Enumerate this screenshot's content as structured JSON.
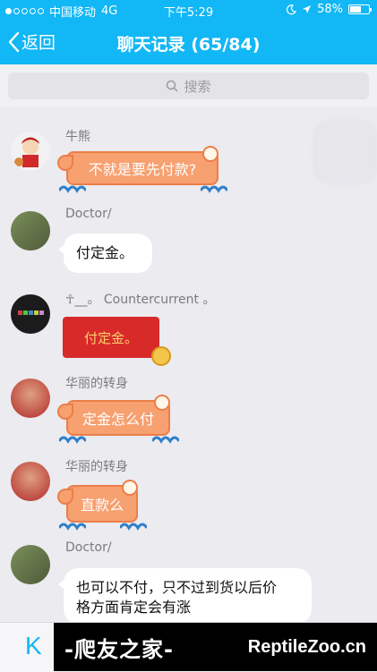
{
  "status_bar": {
    "carrier": "中国移动",
    "network": "4G",
    "time": "下午5:29",
    "battery": "58%",
    "battery_level": 0.58
  },
  "nav": {
    "back_label": "返回",
    "title": "聊天记录 (65/84)"
  },
  "search": {
    "placeholder": "搜索"
  },
  "messages": [
    {
      "sender": "牛熊",
      "text": "不就是要先付款?",
      "style": "fancy-orange"
    },
    {
      "sender": "Doctor/",
      "text": "付定金。",
      "style": "white"
    },
    {
      "sender": "☥__。 Countercurrent 。",
      "text": "付定金。",
      "style": "red-packet"
    },
    {
      "sender": "华丽的转身",
      "text": "定金怎么付",
      "style": "fancy-orange"
    },
    {
      "sender": "华丽的转身",
      "text": "直款么",
      "style": "fancy-orange"
    },
    {
      "sender": "Doctor/",
      "text_lines": [
        "也可以不付，只不过到货以后价",
        "格方面肯定会有涨"
      ],
      "style": "white"
    }
  ],
  "bottom": {
    "left_glyph": "K",
    "watermark_left": "-爬友之家-",
    "watermark_right": "ReptileZoo.cn"
  },
  "colors": {
    "accent": "#12b7f5",
    "fancy_bubble": "#f7a070",
    "red_packet": "#d92a2a"
  }
}
